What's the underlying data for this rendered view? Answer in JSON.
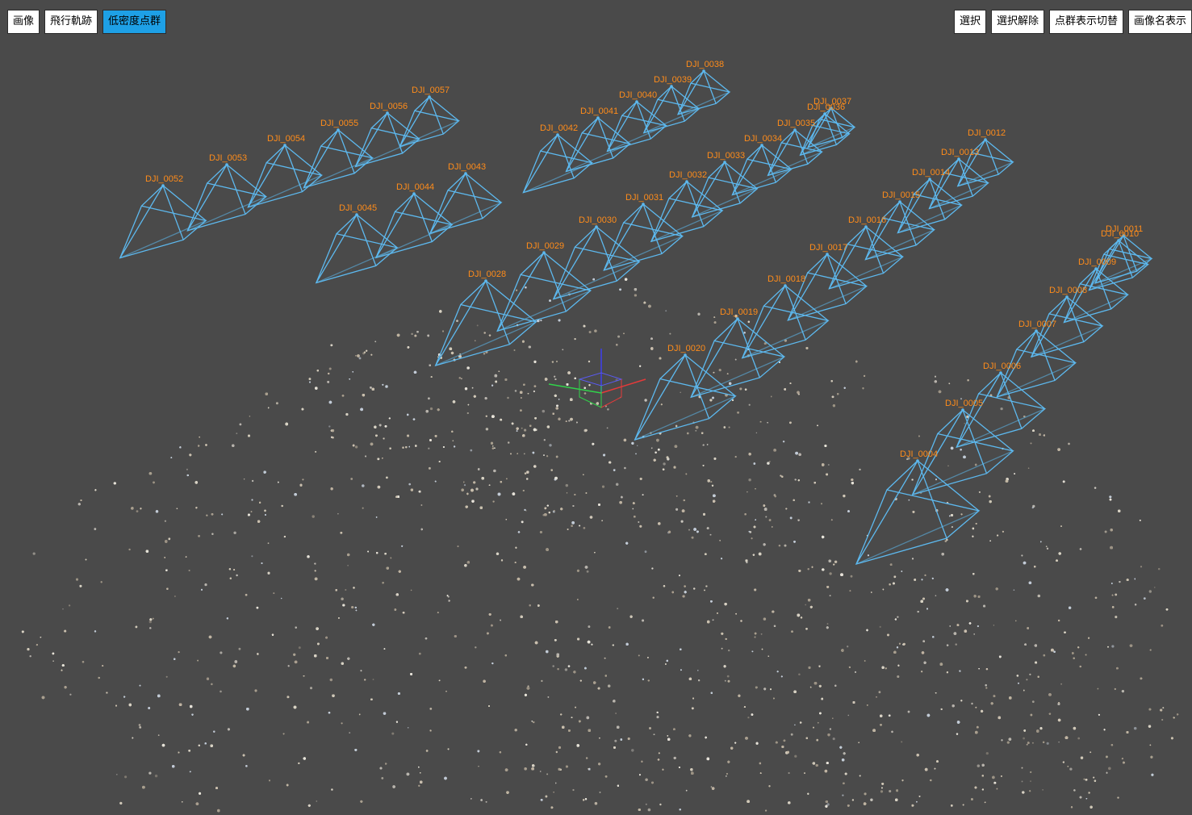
{
  "toolbar_left": [
    {
      "label": "画像",
      "active": false
    },
    {
      "label": "飛行軌跡",
      "active": false
    },
    {
      "label": "低密度点群",
      "active": true
    }
  ],
  "toolbar_right": [
    {
      "label": "選択"
    },
    {
      "label": "選択解除"
    },
    {
      "label": "点群表示切替"
    },
    {
      "label": "画像名表示"
    }
  ],
  "colors": {
    "camera": "#5db9ef",
    "label": "#ff8c1a",
    "background": "#4a4a4a",
    "active_button": "#1ea0e6"
  },
  "cameras": [
    {
      "name": "DJI_0004"
    },
    {
      "name": "DJI_0005"
    },
    {
      "name": "DJI_0006"
    },
    {
      "name": "DJI_0007"
    },
    {
      "name": "DJI_0008"
    },
    {
      "name": "DJI_0009"
    },
    {
      "name": "DJI_0010"
    },
    {
      "name": "DJI_0011"
    },
    {
      "name": "DJI_0012"
    },
    {
      "name": "DJI_0013"
    },
    {
      "name": "DJI_0014"
    },
    {
      "name": "DJI_0015"
    },
    {
      "name": "DJI_0016"
    },
    {
      "name": "DJI_0017"
    },
    {
      "name": "DJI_0018"
    },
    {
      "name": "DJI_0019"
    },
    {
      "name": "DJI_0020"
    },
    {
      "name": "DJI_0028"
    },
    {
      "name": "DJI_0029"
    },
    {
      "name": "DJI_0030"
    },
    {
      "name": "DJI_0031"
    },
    {
      "name": "DJI_0032"
    },
    {
      "name": "DJI_0033"
    },
    {
      "name": "DJI_0034"
    },
    {
      "name": "DJI_0035"
    },
    {
      "name": "DJI_0036"
    },
    {
      "name": "DJI_0037"
    },
    {
      "name": "DJI_0038"
    },
    {
      "name": "DJI_0039"
    },
    {
      "name": "DJI_0040"
    },
    {
      "name": "DJI_0041"
    },
    {
      "name": "DJI_0042"
    },
    {
      "name": "DJI_0043"
    },
    {
      "name": "DJI_0044"
    },
    {
      "name": "DJI_0045"
    },
    {
      "name": "DJI_0052"
    },
    {
      "name": "DJI_0053"
    },
    {
      "name": "DJI_0054"
    },
    {
      "name": "DJI_0055"
    },
    {
      "name": "DJI_0056"
    },
    {
      "name": "DJI_0057"
    }
  ]
}
